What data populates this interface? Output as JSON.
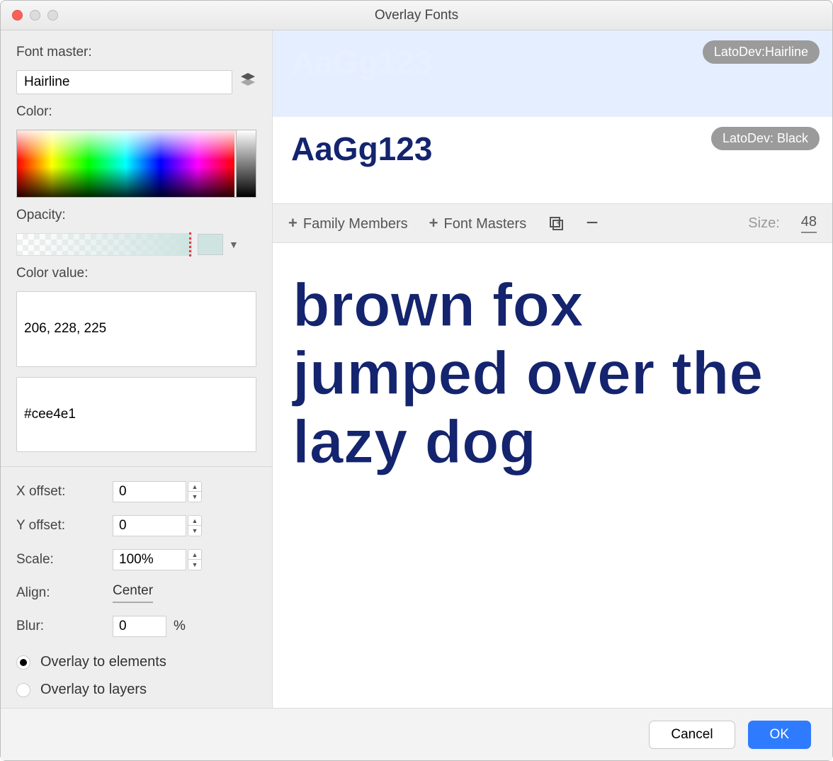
{
  "window": {
    "title": "Overlay Fonts"
  },
  "sidebar": {
    "font_master_label": "Font master:",
    "font_master_value": "Hairline",
    "color_label": "Color:",
    "opacity_label": "Opacity:",
    "color_value_label": "Color value:",
    "color_rgb": "206, 228, 225",
    "color_hex": "#cee4e1",
    "xoffset_label": "X offset:",
    "xoffset_value": "0",
    "yoffset_label": "Y offset:",
    "yoffset_value": "0",
    "scale_label": "Scale:",
    "scale_value": "100%",
    "align_label": "Align:",
    "align_value": "Center",
    "blur_label": "Blur:",
    "blur_value": "0",
    "blur_suffix": "%",
    "radio_elements": "Overlay to elements",
    "radio_layers": "Overlay to layers"
  },
  "previews": [
    {
      "sample": "AaGg123",
      "badge": "LatoDev:Hairline",
      "style": "hairline",
      "selected": true
    },
    {
      "sample": "AaGg123",
      "badge": "LatoDev: Black",
      "style": "black",
      "selected": false
    }
  ],
  "midbar": {
    "family_members": "Family Members",
    "font_masters": "Font Masters",
    "size_label": "Size:",
    "size_value": "48"
  },
  "canvas_text": "brown fox jumped over the lazy dog",
  "footer": {
    "cancel": "Cancel",
    "ok": "OK"
  }
}
